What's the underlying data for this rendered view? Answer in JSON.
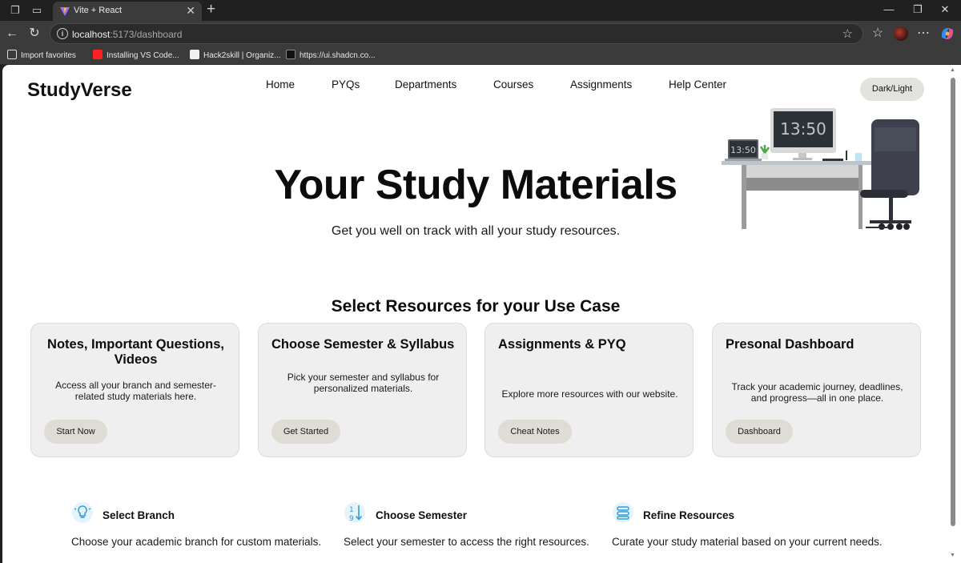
{
  "browser": {
    "tab_title": "Vite + React",
    "url_host": "localhost",
    "url_path": ":5173/dashboard",
    "bookmarks": [
      {
        "label": "Import favorites",
        "icon": "import-icon"
      },
      {
        "label": "Installing VS Code...",
        "icon": "youtube-icon"
      },
      {
        "label": "Hack2skill | Organiz...",
        "icon": "hack2skill-icon"
      },
      {
        "label": "https://ui.shadcn.co...",
        "icon": "shadcn-icon"
      }
    ]
  },
  "header": {
    "brand": "StudyVerse",
    "nav": [
      "Home",
      "PYQs",
      "Departments",
      "Courses",
      "Assignments",
      "Help Center"
    ],
    "theme_toggle": "Dark/Light"
  },
  "hero": {
    "title": "Your Study Materials",
    "subtitle": "Get you well on track with all your study resources.",
    "illustration": {
      "monitor_time": "13:50",
      "laptop_time": "13:50"
    }
  },
  "resources": {
    "title": "Select Resources for your Use Case",
    "cards": [
      {
        "title": "Notes, Important Questions, Videos",
        "description": "Access all your branch and semester-related study materials here.",
        "button": "Start Now"
      },
      {
        "title": "Choose Semester & Syllabus",
        "description": "Pick your semester and syllabus for personalized materials.",
        "button": "Get Started"
      },
      {
        "title": "Assignments & PYQ",
        "description": "Explore more resources with our website.",
        "button": "Cheat Notes"
      },
      {
        "title": "Presonal Dashboard",
        "description": "Track your academic journey, deadlines, and progress—all in one place.",
        "button": "Dashboard"
      }
    ]
  },
  "features": [
    {
      "title": "Select Branch",
      "description": "Choose your academic branch for custom materials.",
      "icon": "lightbulb-icon"
    },
    {
      "title": "Choose Semester",
      "description": "Select your semester to access the right resources.",
      "icon": "sort-numeric-icon"
    },
    {
      "title": "Refine Resources",
      "description": "Curate your study material based on your current needs.",
      "icon": "filter-list-icon"
    }
  ],
  "colors": {
    "accent_icon": "#2a9fd6",
    "card_bg": "#efefef",
    "button_bg": "#dedcd4"
  }
}
